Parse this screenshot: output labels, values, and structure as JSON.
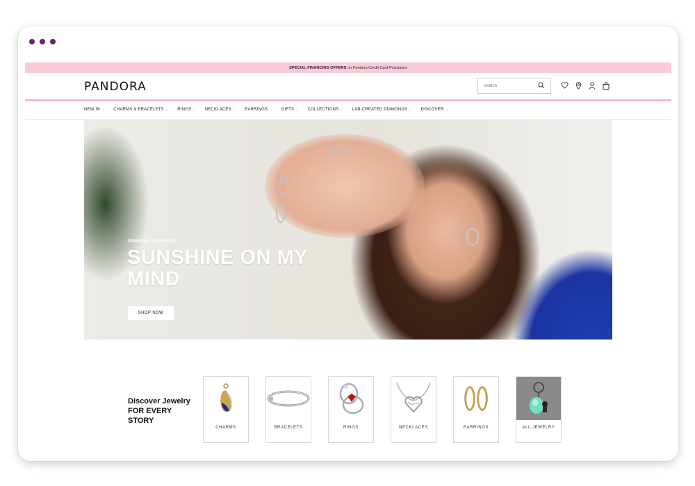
{
  "promo": {
    "bold": "SPECIAL FINANCING OFFERS",
    "text": "on Pandora Credit Card Purchases"
  },
  "header": {
    "logo": "PANDORA",
    "search_placeholder": "Search",
    "icons": [
      "heart-icon",
      "location-pin-icon",
      "user-icon",
      "shopping-bag-icon"
    ]
  },
  "nav": {
    "items": [
      {
        "label": "NEW IN"
      },
      {
        "label": "CHARMS & BRACELETS"
      },
      {
        "label": "RINGS"
      },
      {
        "label": "NECKLACES"
      },
      {
        "label": "EARRINGS"
      },
      {
        "label": "GIFTS"
      },
      {
        "label": "COLLECTIONS"
      },
      {
        "label": "LAB-CREATED DIAMONDS"
      },
      {
        "label": "DISCOVER"
      }
    ]
  },
  "hero": {
    "eyebrow": "PANDORA MOMENTS",
    "headline": "SUNSHINE ON MY MIND",
    "cta": "SHOP NOW"
  },
  "discover": {
    "title_line1": "Discover Jewelry",
    "title_line2": "FOR EVERY",
    "title_line3": "STORY",
    "categories": [
      {
        "label": "CHARMS"
      },
      {
        "label": "BRACELETS"
      },
      {
        "label": "RINGS"
      },
      {
        "label": "NECKLACES"
      },
      {
        "label": "EARRINGS"
      },
      {
        "label": "ALL JEWELRY"
      }
    ]
  },
  "colors": {
    "promo_bg": "#f7ccd6",
    "accent_line": "#f4b9c8",
    "window_dots": "#6b1f7a"
  }
}
